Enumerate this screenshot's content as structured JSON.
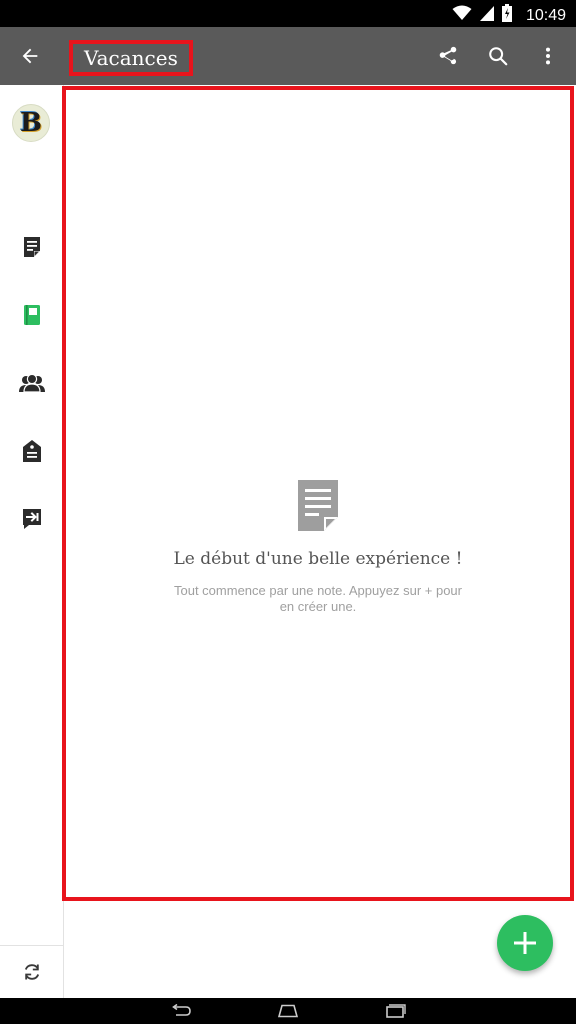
{
  "status_bar": {
    "time": "10:49",
    "icons": [
      "wifi-icon",
      "signal-icon",
      "battery-icon"
    ]
  },
  "app_bar": {
    "title": "Vacances",
    "back_icon": "arrow-back-icon",
    "actions": [
      "share-icon",
      "search-icon",
      "more-vert-icon"
    ]
  },
  "sidebar": {
    "avatar_letter": "B",
    "items": [
      {
        "icon": "note-icon",
        "active": false
      },
      {
        "icon": "notebook-icon",
        "active": true
      },
      {
        "icon": "people-icon",
        "active": false
      },
      {
        "icon": "tag-icon",
        "active": false
      },
      {
        "icon": "shortcut-icon",
        "active": false
      }
    ],
    "sync_icon": "sync-icon"
  },
  "empty_state": {
    "icon": "note-icon",
    "title": "Le début d'une belle expérience !",
    "description": "Tout commence par une note. Appuyez sur + pour en créer une."
  },
  "fab": {
    "icon": "plus-icon"
  },
  "nav_bar": {
    "icons": [
      "back-nav-icon",
      "home-nav-icon",
      "recents-nav-icon"
    ]
  },
  "colors": {
    "app_bar": "#5a5a5a",
    "accent_green": "#2dbe60",
    "highlight_red": "#e8141c",
    "icon_dark": "#2b2b2b",
    "empty_icon_gray": "#9e9e9e"
  }
}
